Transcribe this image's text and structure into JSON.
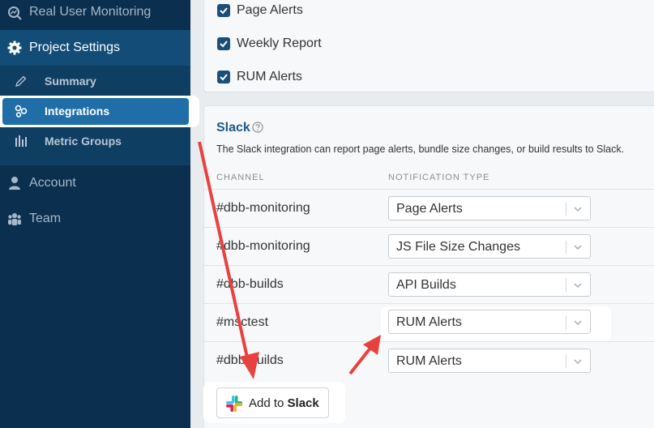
{
  "sidebar": {
    "real_user_monitoring": "Real User Monitoring",
    "project_settings": "Project Settings",
    "summary": "Summary",
    "integrations": "Integrations",
    "metric_groups": "Metric Groups",
    "account": "Account",
    "team": "Team"
  },
  "alerts": {
    "items": [
      {
        "label": "Page Alerts",
        "checked": true
      },
      {
        "label": "Weekly Report",
        "checked": true
      },
      {
        "label": "RUM Alerts",
        "checked": true
      }
    ]
  },
  "slack": {
    "title": "Slack",
    "description": "The Slack integration can report page alerts, bundle size changes, or build results to Slack.",
    "col_channel": "CHANNEL",
    "col_notification": "NOTIFICATION TYPE",
    "rows": [
      {
        "channel": "#dbb-monitoring",
        "type": "Page Alerts"
      },
      {
        "channel": "#dbb-monitoring",
        "type": "JS File Size Changes"
      },
      {
        "channel": "#dbb-builds",
        "type": "API Builds"
      },
      {
        "channel": "#msctest",
        "type": "RUM Alerts"
      },
      {
        "channel": "#dbb-builds",
        "type": "RUM Alerts"
      }
    ],
    "add_button": {
      "prefix": "Add to ",
      "brand": "Slack"
    }
  },
  "colors": {
    "sidebar_bg": "#0b2f4e",
    "active_item": "#1f6ea8",
    "annotation_arrow": "#e8423f",
    "checkbox": "#1b4f7a"
  },
  "icons": [
    "search-chart-icon",
    "gear-icon",
    "pencil-icon",
    "integrations-icon",
    "metric-groups-icon",
    "user-icon",
    "team-icon",
    "checkmark-icon",
    "help-icon",
    "chevron-down-icon",
    "slack-logo"
  ]
}
